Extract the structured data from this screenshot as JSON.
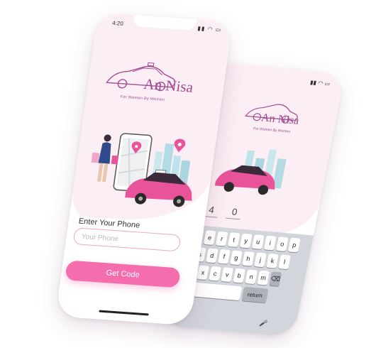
{
  "front": {
    "status_time": "4:20",
    "status_icons": "▮▮ ◠ ▭",
    "logo_title": "An Nisa",
    "logo_tagline": "For Women By Women",
    "phone_label": "Enter Your Phone",
    "phone_placeholder": "Your Phone",
    "button_label": "Get Code"
  },
  "back": {
    "status_icons": "▮▮ ◠ ▭",
    "logo_title": "An Nisa",
    "logo_tagline": "For Women By Women",
    "code_digits": [
      "4",
      "0"
    ],
    "keyboard": {
      "row1": [
        "q",
        "w",
        "e",
        "r",
        "t",
        "y",
        "u",
        "i",
        "o",
        "p"
      ],
      "row2": [
        "a",
        "s",
        "d",
        "f",
        "g",
        "h",
        "j",
        "k",
        "l"
      ],
      "row3": [
        "z",
        "x",
        "c",
        "v",
        "b",
        "n",
        "m"
      ],
      "return_label": "return",
      "backspace_icon": "⌫",
      "mic_icon": "🎤"
    }
  },
  "colors": {
    "accent_pink": "#f46eae",
    "logo_purple": "#a24a92",
    "soft_pink_bg": "#fbeef4",
    "car_pink": "#e8539a"
  }
}
